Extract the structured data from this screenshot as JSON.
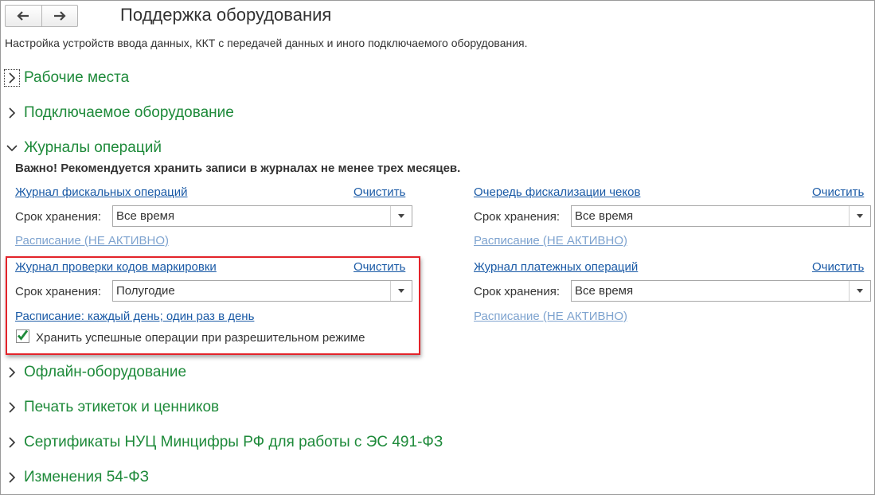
{
  "page": {
    "title": "Поддержка оборудования",
    "subtitle": "Настройка устройств ввода данных, ККТ с передачей данных и иного подключаемого оборудования."
  },
  "sections": {
    "workplaces": "Рабочие места",
    "equipment": "Подключаемое оборудование",
    "journals": "Журналы операций",
    "offline": "Офлайн-оборудование",
    "labels": "Печать этикеток и ценников",
    "certs": "Сертификаты НУЦ Минцифры РФ для работы с ЭС 491-ФЗ",
    "changes": "Изменения 54-ФЗ"
  },
  "journals": {
    "warning": "Важно! Рекомендуется хранить записи в журналах не менее трех месяцев.",
    "retention_label": "Срок хранения:",
    "clear_label": "Очистить",
    "fiscal": {
      "title": "Журнал фискальных операций",
      "retention": "Все время",
      "schedule": "Расписание (НЕ АКТИВНО)"
    },
    "queue": {
      "title": "Очередь фискализации чеков",
      "retention": "Все время",
      "schedule": "Расписание (НЕ АКТИВНО)"
    },
    "marking": {
      "title": "Журнал проверки кодов маркировки",
      "retention": "Полугодие",
      "schedule": "Расписание: каждый день; один раз в день",
      "store_successful": "Хранить успешные операции при разрешительном режиме",
      "store_successful_checked": true
    },
    "payments": {
      "title": "Журнал платежных операций",
      "retention": "Все время",
      "schedule": "Расписание (НЕ АКТИВНО)"
    }
  },
  "colors": {
    "section_green": "#1e8a3a",
    "link_blue": "#1a5aa6",
    "highlight_red": "#e3232a"
  }
}
